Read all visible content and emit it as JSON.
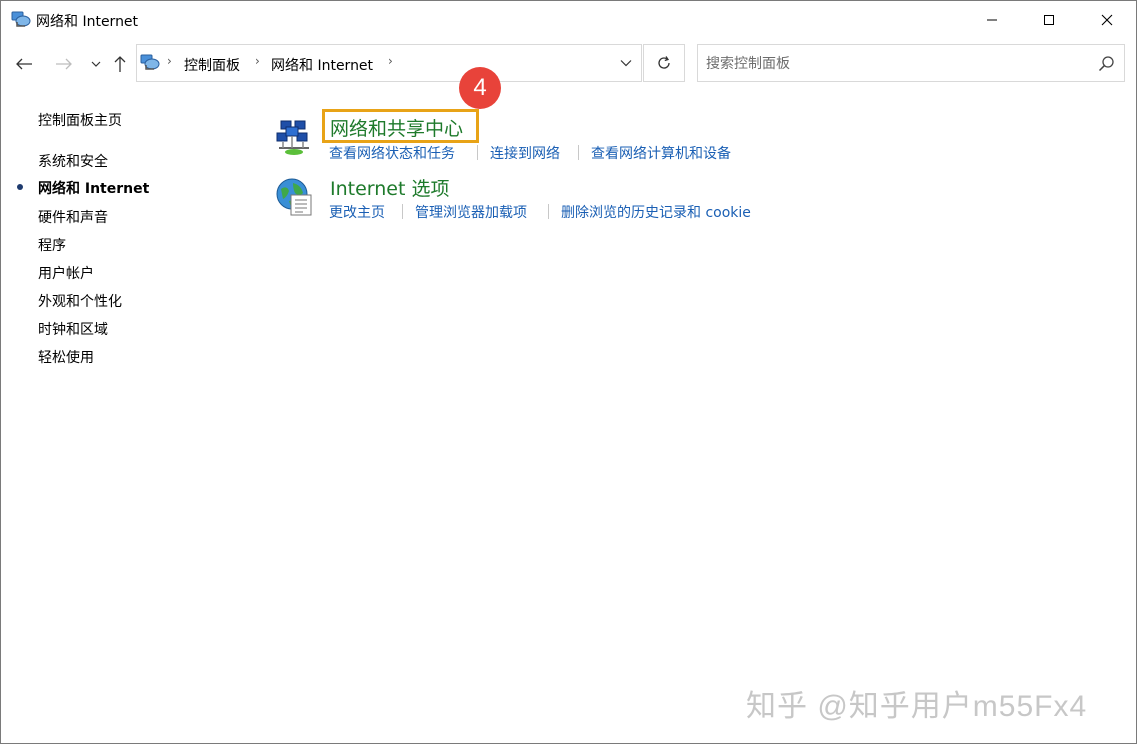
{
  "window": {
    "title": "网络和 Internet",
    "icon": "network-internet-icon"
  },
  "address": {
    "crumbs": [
      "控制面板",
      "网络和 Internet"
    ],
    "separator": "›"
  },
  "search": {
    "placeholder": "搜索控制面板"
  },
  "sidebar": {
    "home": "控制面板主页",
    "items": [
      {
        "label": "系统和安全",
        "current": false
      },
      {
        "label": "网络和 Internet",
        "current": true
      },
      {
        "label": "硬件和声音",
        "current": false
      },
      {
        "label": "程序",
        "current": false
      },
      {
        "label": "用户帐户",
        "current": false
      },
      {
        "label": "外观和个性化",
        "current": false
      },
      {
        "label": "时钟和区域",
        "current": false
      },
      {
        "label": "轻松使用",
        "current": false
      }
    ]
  },
  "categories": [
    {
      "title": "网络和共享中心",
      "icon": "network-sharing-center-icon",
      "links": [
        "查看网络状态和任务",
        "连接到网络",
        "查看网络计算机和设备"
      ]
    },
    {
      "title": "Internet 选项",
      "icon": "internet-options-icon",
      "links": [
        "更改主页",
        "管理浏览器加载项",
        "删除浏览的历史记录和 cookie"
      ]
    }
  ],
  "annotation": {
    "step": "4"
  },
  "watermark": "知乎 @知乎用户m55Fx4",
  "colors": {
    "link": "#1a5fb4",
    "category_title": "#1e7a2b",
    "highlight_box": "#e8a317",
    "badge": "#e8433a"
  }
}
